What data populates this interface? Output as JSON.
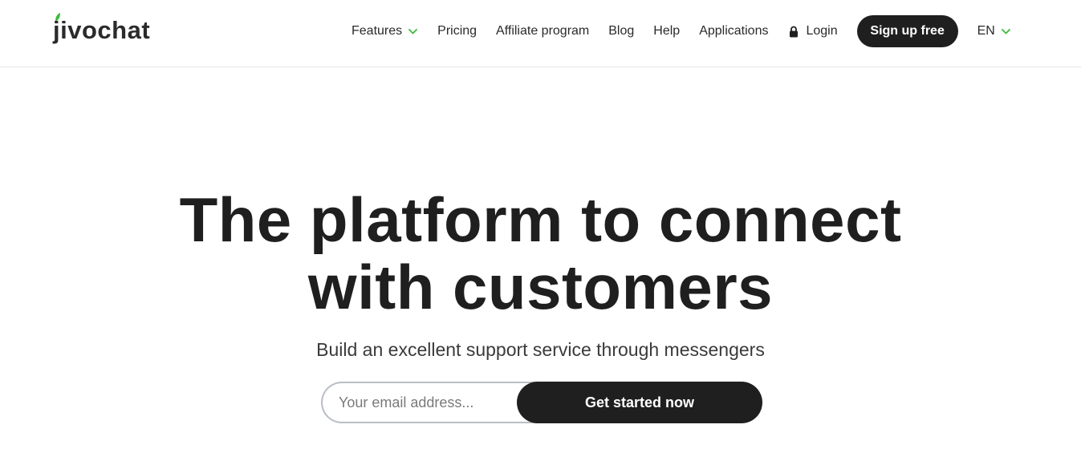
{
  "header": {
    "logo_text": "jivochat",
    "brand_color": "#3cba3c",
    "nav": {
      "features": "Features",
      "pricing": "Pricing",
      "affiliate": "Affiliate program",
      "blog": "Blog",
      "help": "Help",
      "applications": "Applications",
      "login": "Login",
      "signup": "Sign up free",
      "language": "EN"
    }
  },
  "hero": {
    "title_line1": "The platform to connect",
    "title_line2": "with customers",
    "subtitle": "Build an excellent support service through messengers",
    "email_placeholder": "Your email address...",
    "cta": "Get started now"
  },
  "colors": {
    "text_dark": "#1f1f1f",
    "accent_green": "#3cba3c",
    "input_border": "#b9bec6"
  },
  "icons": {
    "features_chevron": "chevron-down-icon",
    "lang_chevron": "chevron-down-icon",
    "login": "lock-icon",
    "logo_leaf": "leaf-icon"
  }
}
